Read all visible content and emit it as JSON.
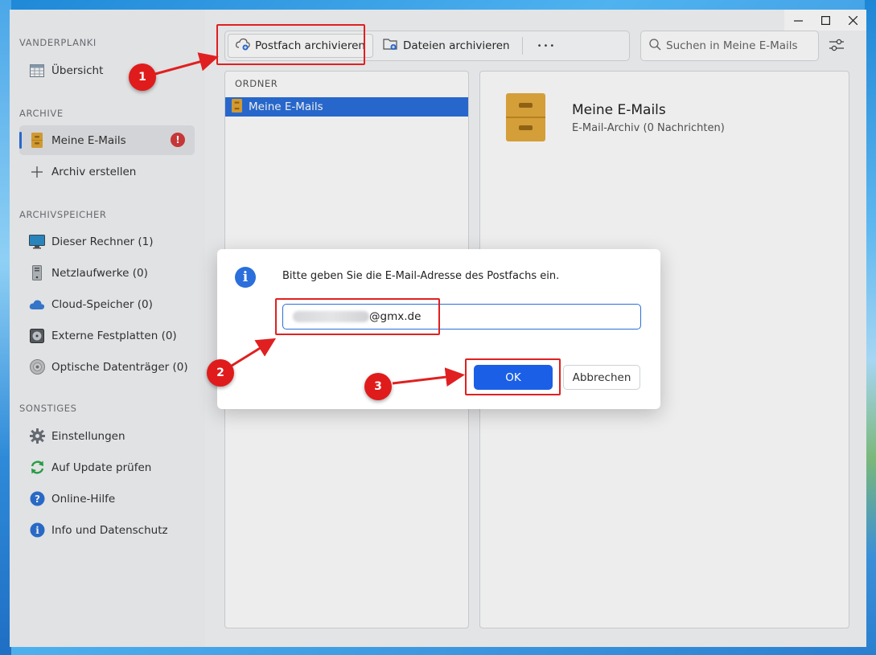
{
  "window": {
    "minimize_icon": "minimize-icon",
    "maximize_icon": "maximize-icon",
    "close_icon": "close-icon"
  },
  "sidebar": {
    "section_vanderplanki": "VANDERPLANKI",
    "overview_label": "Übersicht",
    "section_archive": "ARCHIVE",
    "my_emails_label": "Meine E-Mails",
    "warning_badge": "!",
    "create_archive_label": "Archiv erstellen",
    "section_storage": "ARCHIVSPEICHER",
    "storage_items": [
      {
        "label": "Dieser Rechner (1)",
        "icon": "monitor-icon"
      },
      {
        "label": "Netzlaufwerke (0)",
        "icon": "server-icon"
      },
      {
        "label": "Cloud-Speicher (0)",
        "icon": "cloud-icon"
      },
      {
        "label": "Externe Festplatten (0)",
        "icon": "harddrive-icon"
      },
      {
        "label": "Optische Datenträger (0)",
        "icon": "disc-icon"
      }
    ],
    "section_misc": "SONSTIGES",
    "misc_items": [
      {
        "label": "Einstellungen",
        "icon": "gear-icon"
      },
      {
        "label": "Auf Update prüfen",
        "icon": "refresh-icon"
      },
      {
        "label": "Online-Hilfe",
        "icon": "help-icon"
      },
      {
        "label": "Info und Datenschutz",
        "icon": "info-icon"
      }
    ]
  },
  "toolbar": {
    "archive_mailbox_label": "Postfach archivieren",
    "archive_files_label": "Dateien archivieren",
    "more_label": "•••"
  },
  "search": {
    "placeholder": "Suchen in Meine E-Mails"
  },
  "folders": {
    "header": "ORDNER",
    "items": [
      {
        "label": "Meine E-Mails",
        "selected": true
      }
    ]
  },
  "details": {
    "title": "Meine E-Mails",
    "subtitle": "E-Mail-Archiv (0 Nachrichten)"
  },
  "dialog": {
    "message": "Bitte geben Sie die E-Mail-Adresse des Postfachs ein.",
    "email_domain": "@gmx.de",
    "ok_label": "OK",
    "cancel_label": "Abbrechen"
  },
  "annotations": {
    "step1": "1",
    "step2": "2",
    "step3": "3",
    "color": "#e02020"
  },
  "colors": {
    "accent": "#2a6fdb",
    "ok_button": "#1a5fe6",
    "warning": "#d63c3c"
  }
}
